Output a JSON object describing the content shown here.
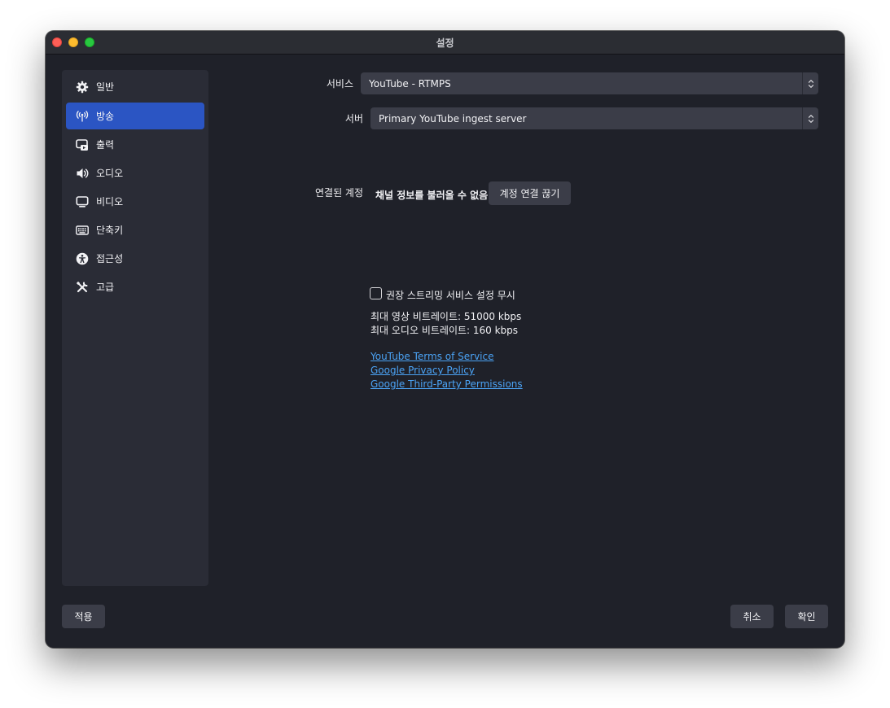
{
  "window": {
    "title": "설정"
  },
  "sidebar": {
    "items": [
      {
        "label": "일반",
        "icon": "gear-icon"
      },
      {
        "label": "방송",
        "icon": "broadcast-antenna-icon",
        "active": true
      },
      {
        "label": "출력",
        "icon": "output-icon"
      },
      {
        "label": "오디오",
        "icon": "speaker-icon"
      },
      {
        "label": "비디오",
        "icon": "monitor-icon"
      },
      {
        "label": "단축키",
        "icon": "keyboard-icon"
      },
      {
        "label": "접근성",
        "icon": "accessibility-icon"
      },
      {
        "label": "고급",
        "icon": "tools-icon"
      }
    ]
  },
  "stream": {
    "service_label": "서비스",
    "service_value": "YouTube - RTMPS",
    "server_label": "서버",
    "server_value": "Primary YouTube ingest server",
    "account_label": "연결된 계정",
    "account_status": "채널 정보를 불러올 수 없음.",
    "disconnect_label": "계정 연결 끊기",
    "ignore_recommended_label": "권장 스트리밍 서비스 설정 무시",
    "ignore_recommended_checked": false,
    "max_video_bitrate": "최대 영상 비트레이트: 51000 kbps",
    "max_audio_bitrate": "최대 오디오 비트레이트: 160 kbps",
    "links": [
      "YouTube Terms of Service",
      "Google Privacy Policy",
      "Google Third-Party Permissions"
    ]
  },
  "footer": {
    "apply_label": "적용",
    "cancel_label": "취소",
    "ok_label": "확인"
  },
  "colors": {
    "accent": "#2b55c3",
    "link": "#4ba3f5",
    "background": "#1f2129",
    "panel": "#2a2c36"
  }
}
